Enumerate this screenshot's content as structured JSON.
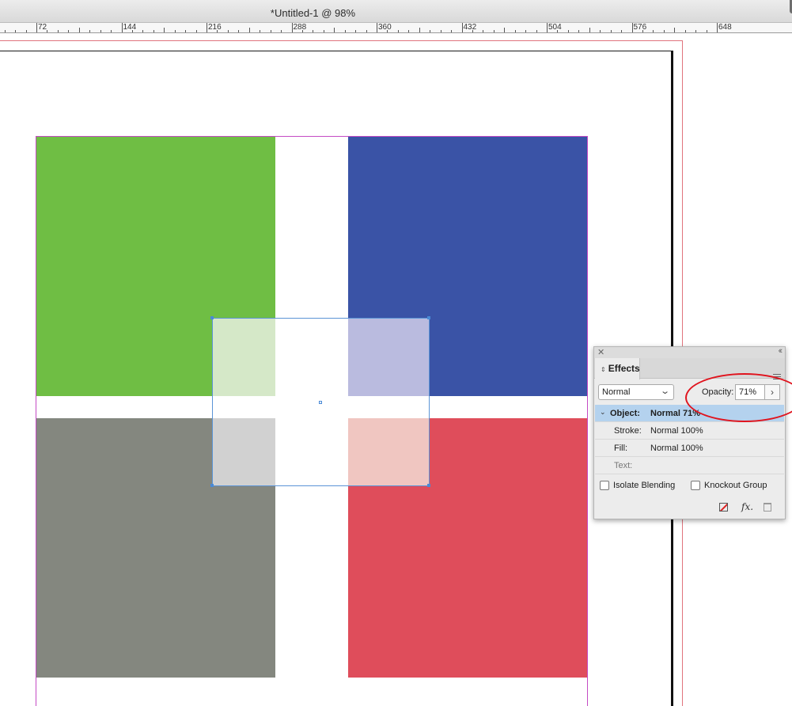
{
  "window": {
    "title": "*Untitled-1 @ 98%"
  },
  "ruler": {
    "labels": [
      "72",
      "144",
      "216",
      "288",
      "360",
      "432",
      "504",
      "576",
      "648"
    ]
  },
  "canvas": {
    "squares": [
      {
        "name": "green-square",
        "color": "#6fbe44"
      },
      {
        "name": "blue-square",
        "color": "#3a53a6"
      },
      {
        "name": "gray-square",
        "color": "#84877f"
      },
      {
        "name": "red-square",
        "color": "#df4d5b"
      }
    ],
    "overlay_tints": {
      "green": "#d5e8c8",
      "blue": "#babbdf",
      "gray": "#d1d1d1",
      "red": "#f0c6c1"
    }
  },
  "effects_panel": {
    "tab_label": "Effects",
    "blend_mode": "Normal",
    "opacity_label": "Opacity:",
    "opacity_value": "71%",
    "rows": {
      "object": {
        "label": "Object:",
        "value": "Normal 71%"
      },
      "stroke": {
        "label": "Stroke:",
        "value": "Normal 100%"
      },
      "fill": {
        "label": "Fill:",
        "value": "Normal 100%"
      },
      "text": {
        "label": "Text:",
        "value": ""
      }
    },
    "isolate_blending_label": "Isolate Blending",
    "knockout_group_label": "Knockout Group",
    "fx_label": "fx."
  },
  "annotation_color": "#e0141e"
}
